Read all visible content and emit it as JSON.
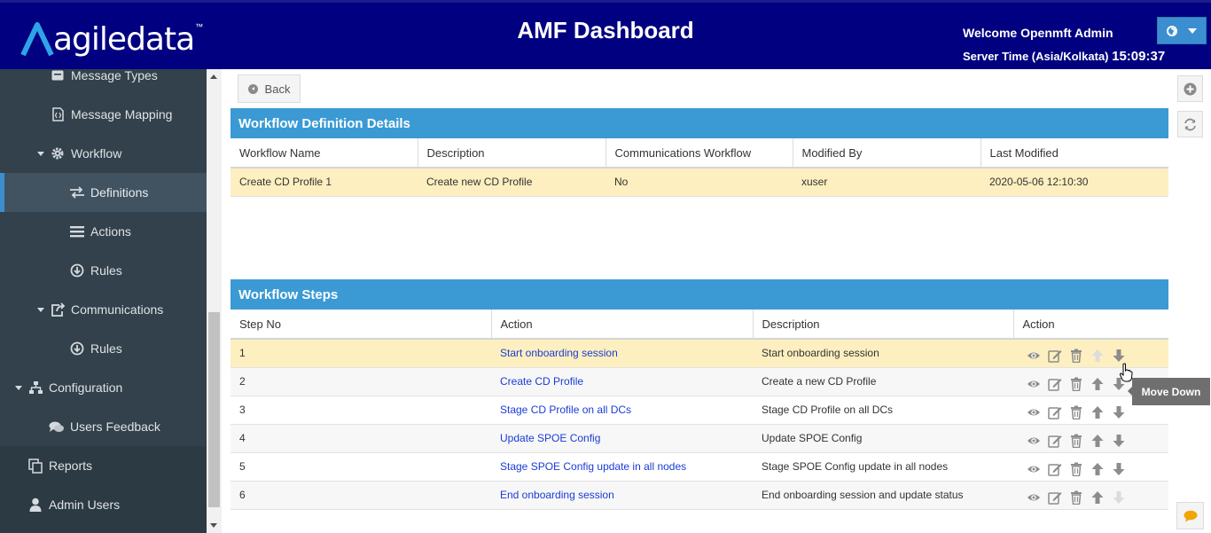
{
  "header": {
    "logo_text": "agiledata",
    "logo_tm": "™",
    "title": "AMF Dashboard",
    "welcome": "Welcome Openmft Admin",
    "server_time_label": "Server Time (Asia/Kolkata)",
    "server_time_value": "15:09:37",
    "brand_color": "#000080"
  },
  "sidebar": {
    "items": [
      {
        "label": "Message Types",
        "icon": "envelope-icon"
      },
      {
        "label": "Message Mapping",
        "icon": "file-code-icon"
      },
      {
        "label": "Workflow",
        "icon": "gear-icon"
      },
      {
        "label": "Definitions",
        "icon": "exchange-icon",
        "active": true
      },
      {
        "label": "Actions",
        "icon": "list-icon"
      },
      {
        "label": "Rules",
        "icon": "circle-arrow-down-icon"
      },
      {
        "label": "Communications",
        "icon": "share-square-icon"
      },
      {
        "label": "Rules",
        "icon": "circle-arrow-down-icon"
      },
      {
        "label": "Configuration",
        "icon": "sitemap-icon"
      },
      {
        "label": "Users Feedback",
        "icon": "comments-icon"
      },
      {
        "label": "Reports",
        "icon": "copy-icon"
      },
      {
        "label": "Admin Users",
        "icon": "user-icon"
      }
    ]
  },
  "toolbar": {
    "back_label": "Back"
  },
  "definition": {
    "title": "Workflow Definition Details",
    "columns": [
      "Workflow Name",
      "Description",
      "Communications Workflow",
      "Modified By",
      "Last Modified"
    ],
    "row": [
      "Create CD Profile 1",
      "Create new CD Profile",
      "No",
      "xuser",
      "2020-05-06 12:10:30"
    ]
  },
  "steps": {
    "title": "Workflow Steps",
    "columns": [
      "Step No",
      "Action",
      "Description",
      "Action"
    ],
    "rows": [
      {
        "no": "1",
        "action": "Start onboarding session",
        "description": "Start onboarding session"
      },
      {
        "no": "2",
        "action": "Create CD Profile",
        "description": "Create a new CD Profile"
      },
      {
        "no": "3",
        "action": "Stage CD Profile on all DCs",
        "description": "Stage CD Profile on all DCs"
      },
      {
        "no": "4",
        "action": "Update SPOE Config",
        "description": "Update SPOE Config"
      },
      {
        "no": "5",
        "action": "Stage SPOE Config update in all nodes",
        "description": "Stage SPOE Config update in all nodes"
      },
      {
        "no": "6",
        "action": "End onboarding session",
        "description": "End onboarding session and update status"
      }
    ]
  },
  "tooltip": {
    "text": "Move Down"
  }
}
